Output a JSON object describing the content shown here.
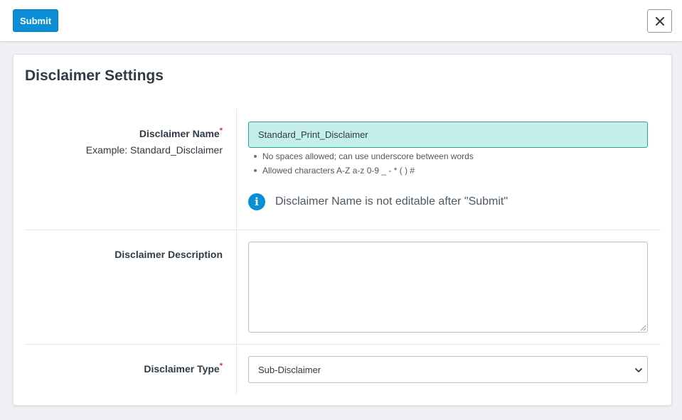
{
  "toolbar": {
    "submit_label": "Submit",
    "close_icon": "close-icon",
    "close_glyph": "✕"
  },
  "form": {
    "title": "Disclaimer Settings",
    "name": {
      "label": "Disclaimer Name",
      "required_mark": "*",
      "example": "Example: Standard_Disclaimer",
      "value": "Standard_Print_Disclaimer",
      "hints": [
        "No spaces allowed; can use underscore between words",
        "Allowed characters A-Z a-z 0-9 _ - * ( ) #"
      ],
      "info_icon": "info-icon",
      "info_glyph": "i",
      "info_text": "Disclaimer Name is not editable after \"Submit\""
    },
    "description": {
      "label": "Disclaimer Description",
      "value": ""
    },
    "type": {
      "label": "Disclaimer Type",
      "required_mark": "*",
      "selected": "Sub-Disclaimer"
    }
  },
  "colors": {
    "primary": "#0a8fd6",
    "input_highlight": "#c4efed",
    "required": "#d63333"
  }
}
